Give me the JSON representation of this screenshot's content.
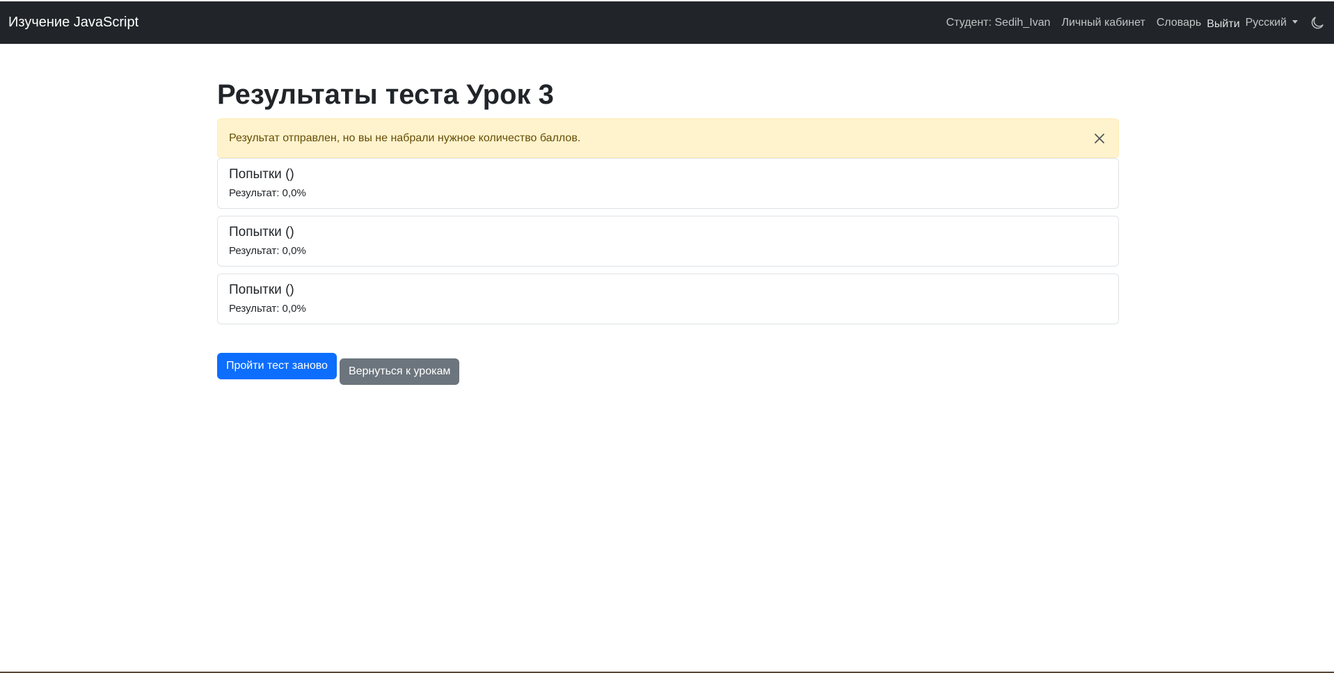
{
  "navbar": {
    "brand": "Изучение JavaScript",
    "student": "Студент: Sedih_Ivan",
    "cabinet": "Личный кабинет",
    "dictionary": "Словарь",
    "logout": "Выйти",
    "language": "Русский",
    "theme_icon": "moon-icon"
  },
  "page": {
    "title": "Результаты теста Урок 3"
  },
  "alert": {
    "message": "Результат отправлен, но вы не набрали нужное количество баллов.",
    "close_icon": "close-icon",
    "color": "#fff3cd"
  },
  "attempts": [
    {
      "title": "Попытки ()",
      "result": "Результат: 0,0%"
    },
    {
      "title": "Попытки ()",
      "result": "Результат: 0,0%"
    },
    {
      "title": "Попытки ()",
      "result": "Результат: 0,0%"
    }
  ],
  "actions": {
    "retry_label": "Пройти тест заново",
    "back_label": "Вернуться к урокам"
  },
  "colors": {
    "navbar": "#212529",
    "primary": "#0d6efd",
    "secondary": "#6c757d"
  }
}
